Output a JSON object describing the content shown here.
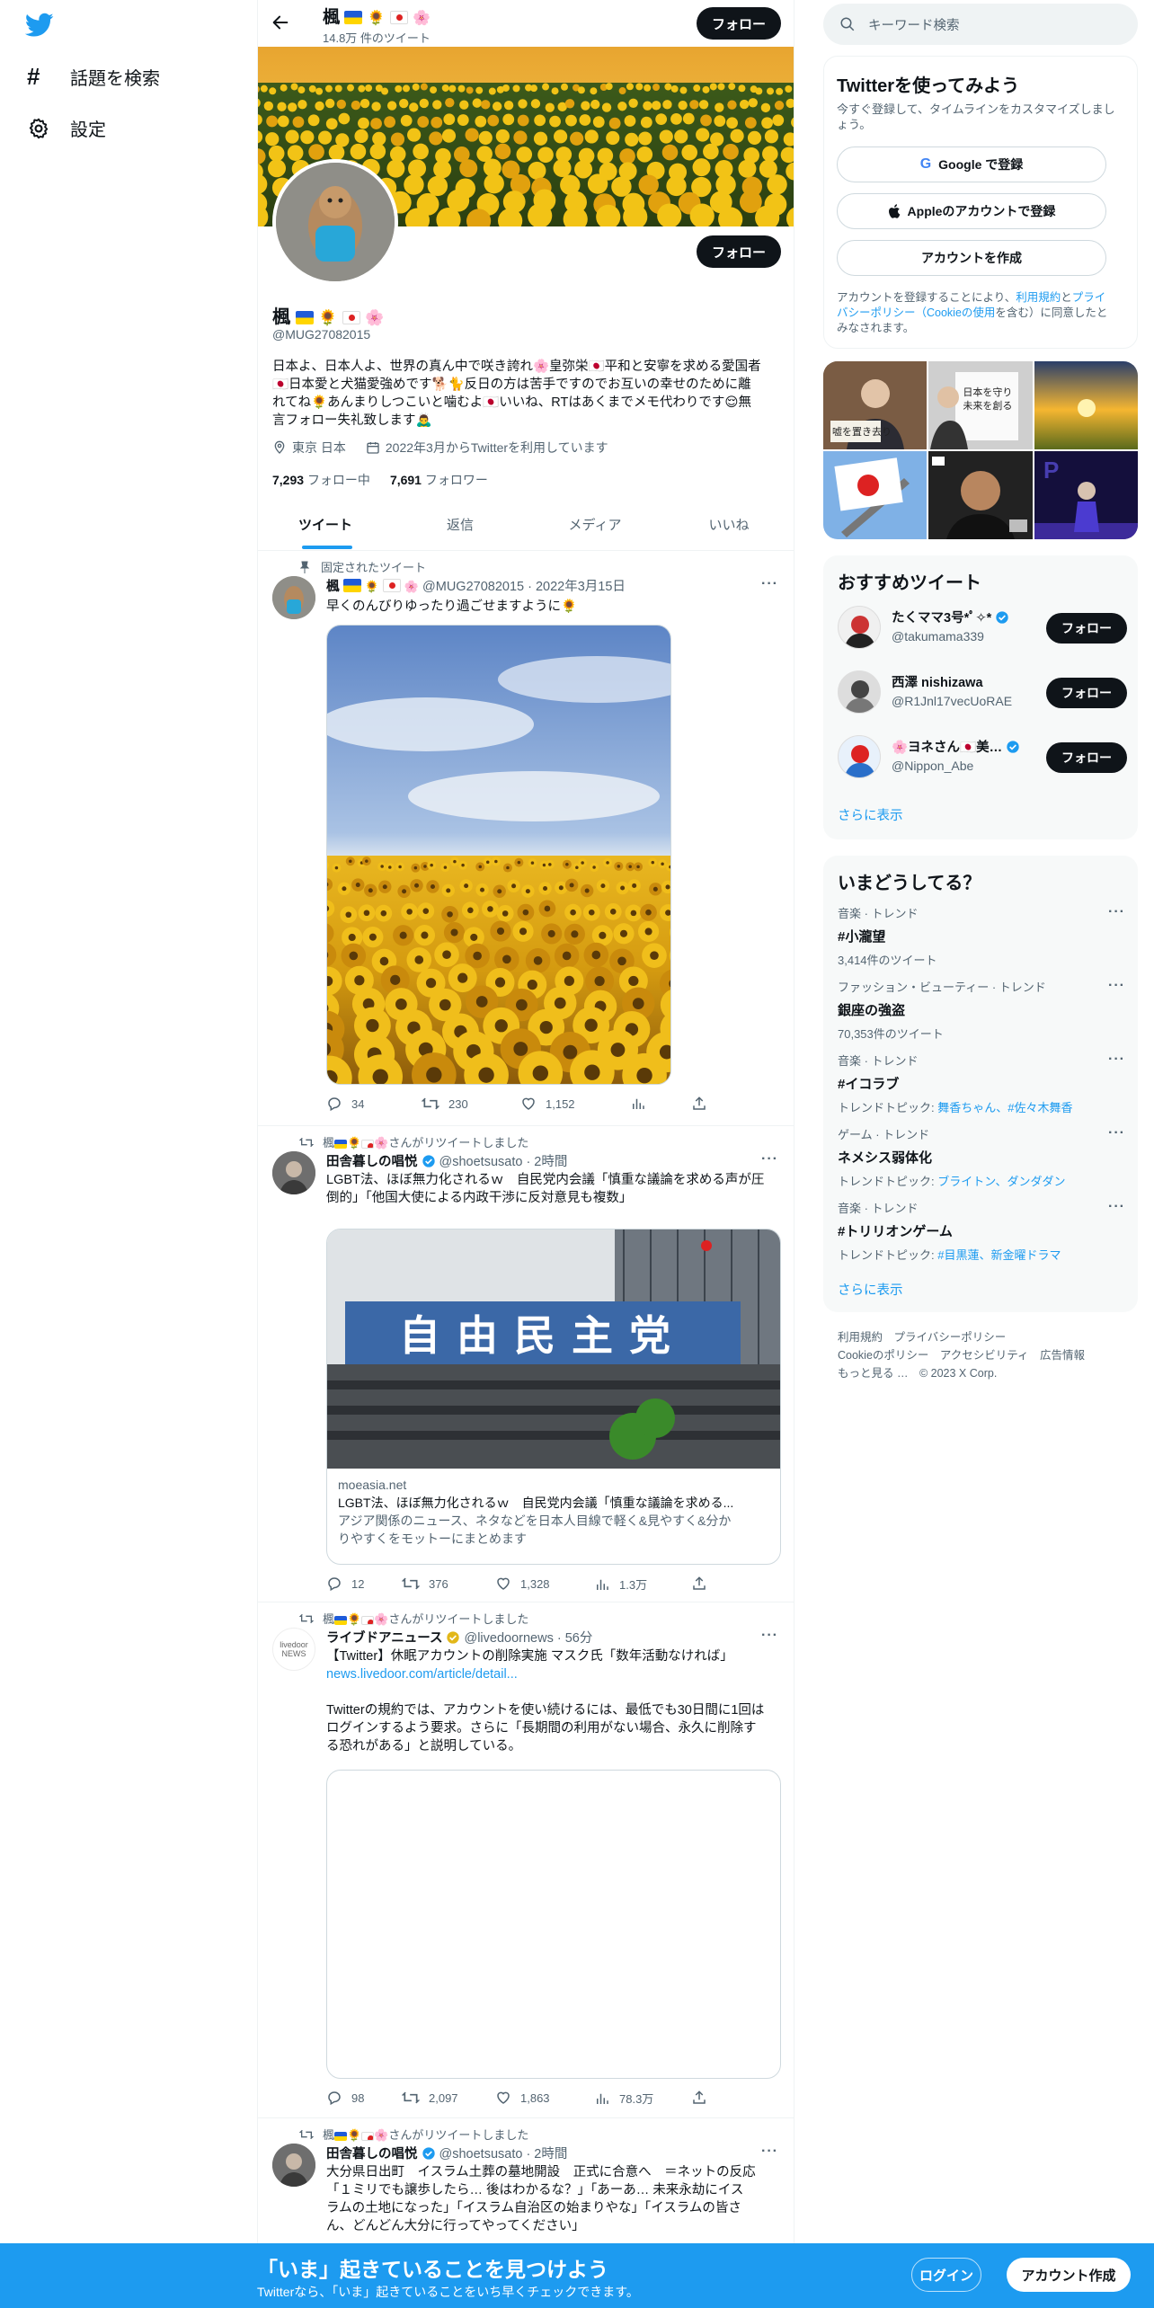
{
  "nav": {
    "explore": "話題を検索",
    "settings": "設定"
  },
  "header": {
    "name": "楓",
    "tweet_count": "14.8万 件のツイート",
    "follow_label": "フォロー"
  },
  "profile": {
    "name": "楓",
    "handle": "@MUG27082015",
    "bio_line1": "日本よ、日本人よ、世界の真ん中で咲き誇れ🌸皇弥栄🇯🇵平和と安寧を求める愛国者",
    "bio_line2": "🇯🇵日本愛と犬猫愛強めです🐕🐈反日の方は苦手ですのでお互いの幸せのために離",
    "bio_line3": "れてね🌻あんまりしつこいと噛むよ🇯🇵いいね、RTはあくまでメモ代わりです😌無",
    "bio_line4": "言フォロー失礼致します🙇‍♂️",
    "location": "東京 日本",
    "joined": "2022年3月からTwitterを利用しています",
    "following_count": "7,293",
    "following_label": "フォロー中",
    "followers_count": "7,691",
    "followers_label": "フォロワー",
    "follow_label": "フォロー"
  },
  "tabs": [
    {
      "label": "ツイート"
    },
    {
      "label": "返信"
    },
    {
      "label": "メディア"
    },
    {
      "label": "いいね"
    }
  ],
  "tweets": [
    {
      "context": "固定されたツイート",
      "author": "楓",
      "handle_time": "@MUG27082015 · 2022年3月15日",
      "text": "早くのんびりゆったり過ごせますように🌻",
      "replies": "34",
      "retweets": "230",
      "likes": "1,152",
      "views": ""
    },
    {
      "context": "さんがリツイートしました",
      "context_prefix": "楓",
      "author": "田舎暮しの唱悦",
      "handle_time": "@shoetsusato · 2時間",
      "text1": "LGBT法、ほぼ無力化されるｗ　自民党内会議「慎重な議論を求める声が圧",
      "text2": "倒的」「他国大使による内政干渉に反対意見も複数」",
      "card_sign": "自由民主党",
      "card_domain": "moeasia.net",
      "card_title": "LGBT法、ほぼ無力化されるｗ　自民党内会議「慎重な議論を求める...",
      "card_desc1": "アジア関係のニュース、ネタなどを日本人目線で軽く&見やすく&分か",
      "card_desc2": "りやすくをモットーにまとめます",
      "replies": "12",
      "retweets": "376",
      "likes": "1,328",
      "views": "1.3万"
    },
    {
      "context": "さんがリツイートしました",
      "context_prefix": "楓",
      "author": "ライブドアニュース",
      "handle_time": "@livedoornews · 56分",
      "avatar_text": "livedoor NEWS",
      "text1": "【Twitter】休眠アカウントの削除実施 マスク氏「数年活動なければ」",
      "link": "news.livedoor.com/article/detail...",
      "text2": "Twitterの規約では、アカウントを使い続けるには、最低でも30日間に1回は",
      "text3": "ログインするよう要求。さらに「長期間の利用がない場合、永久に削除す",
      "text4": "る恐れがある」と説明している。",
      "replies": "98",
      "retweets": "2,097",
      "likes": "1,863",
      "views": "78.3万"
    },
    {
      "context": "さんがリツイートしました",
      "context_prefix": "楓",
      "author": "田舎暮しの唱悦",
      "handle_time": "@shoetsusato · 2時間",
      "text1": "大分県日出町　イスラム土葬の墓地開設　正式に合意へ　＝ネットの反応",
      "text2": "「１ミリでも譲歩したら… 後はわかるな？」「あーあ… 未来永劫にイス",
      "text3": "ラムの土地になった」「イスラム自治区の始まりやな」「イスラムの皆さ",
      "text4": "ん、どんどん大分に行ってやってください」"
    }
  ],
  "right": {
    "search_placeholder": "キーワード検索",
    "signup_title": "Twitterを使ってみよう",
    "signup_sub1": "今すぐ登録して、タイムラインをカスタマイズしまし",
    "signup_sub2": "ょう。",
    "google_btn": "Google で登録",
    "apple_btn": "Appleのアカウントで登録",
    "create_btn": "アカウントを作成",
    "terms1_a": "アカウントを登録することにより、",
    "terms1_link1": "利用規約",
    "terms1_b": "と",
    "terms1_link2": "プライ",
    "terms2_link": "バシーポリシー（Cookieの使用",
    "terms2_b": "を含む）に同意したと",
    "terms3": "みなされます。",
    "media_sign1": "日本を守り",
    "media_sign2": "未来を創る",
    "media_small_sign": "嘘を置き去り",
    "recommended_title": "おすすめツイート",
    "recommended": [
      {
        "name": "たくママ3号*ﾟ✧*",
        "handle": "@takumama339",
        "verified": true
      },
      {
        "name": "西澤 nishizawa",
        "handle": "@R1Jnl17vecUoRAE",
        "verified": false
      },
      {
        "name": "🌸ヨネさん🇯🇵美…",
        "handle": "@Nippon_Abe",
        "verified": true
      }
    ],
    "follow_label": "フォロー",
    "show_more": "さらに表示",
    "trends_title": "いまどうしてる？",
    "trends": [
      {
        "category": "音楽 · トレンド",
        "name": "#小瀧望",
        "sub": "3,414件のツイート",
        "sub_prefix": "",
        "sub_link": ""
      },
      {
        "category": "ファッション・ビューティー · トレンド",
        "name": "銀座の強盗",
        "sub": "70,353件のツイート",
        "sub_prefix": "",
        "sub_link": ""
      },
      {
        "category": "音楽 · トレンド",
        "name": "#イコラブ",
        "sub": "",
        "sub_prefix": "トレンドトピック: ",
        "sub_link": "舞香ちゃん、#佐々木舞香"
      },
      {
        "category": "ゲーム · トレンド",
        "name": "ネメシス弱体化",
        "sub": "",
        "sub_prefix": "トレンドトピック: ",
        "sub_link": "ブライトン、ダンダダン"
      },
      {
        "category": "音楽 · トレンド",
        "name": "#トリリオンゲーム",
        "sub": "",
        "sub_prefix": "トレンドトピック: ",
        "sub_link": "#目黒蓮、新金曜ドラマ"
      }
    ],
    "footer1": "利用規約　プライバシーポリシー",
    "footer2": "Cookieのポリシー　アクセシビリティ　広告情報",
    "footer3": "もっと見る …　© 2023 X Corp."
  },
  "bottom": {
    "title": "「いま」起きていることを見つけよう",
    "sub": "Twitterなら、「いま」起きていることをいち早くチェックできます。",
    "login": "ログイン",
    "signup": "アカウント作成"
  },
  "colors": {
    "accent": "#1d9bf0",
    "dark": "#0f1419",
    "muted": "#536471"
  }
}
